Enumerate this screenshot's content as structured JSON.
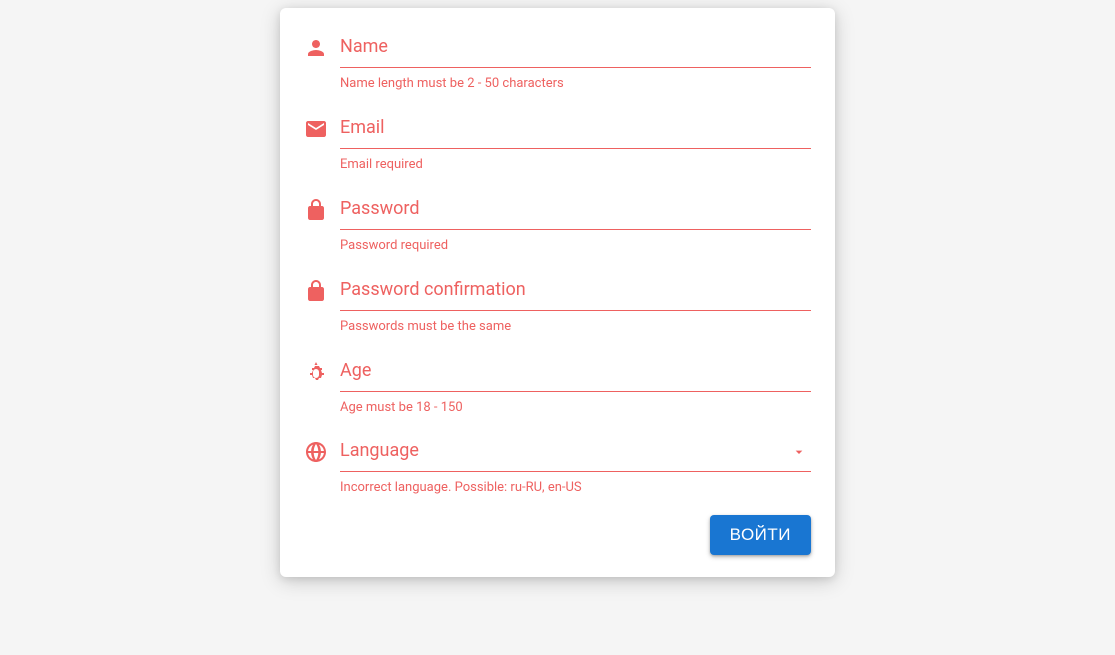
{
  "colors": {
    "error": "#ee6160",
    "primary": "#1976d2"
  },
  "form": {
    "fields": {
      "name": {
        "label": "Name",
        "error": "Name length must be 2 - 50 characters"
      },
      "email": {
        "label": "Email",
        "error": "Email required"
      },
      "password": {
        "label": "Password",
        "error": "Password required"
      },
      "password_confirm": {
        "label": "Password confirmation",
        "error": "Passwords must be the same"
      },
      "age": {
        "label": "Age",
        "error": "Age must be 18 - 150"
      },
      "language": {
        "label": "Language",
        "error": "Incorrect language. Possible: ru-RU, en-US"
      }
    },
    "submit_label": "ВОЙТИ"
  }
}
